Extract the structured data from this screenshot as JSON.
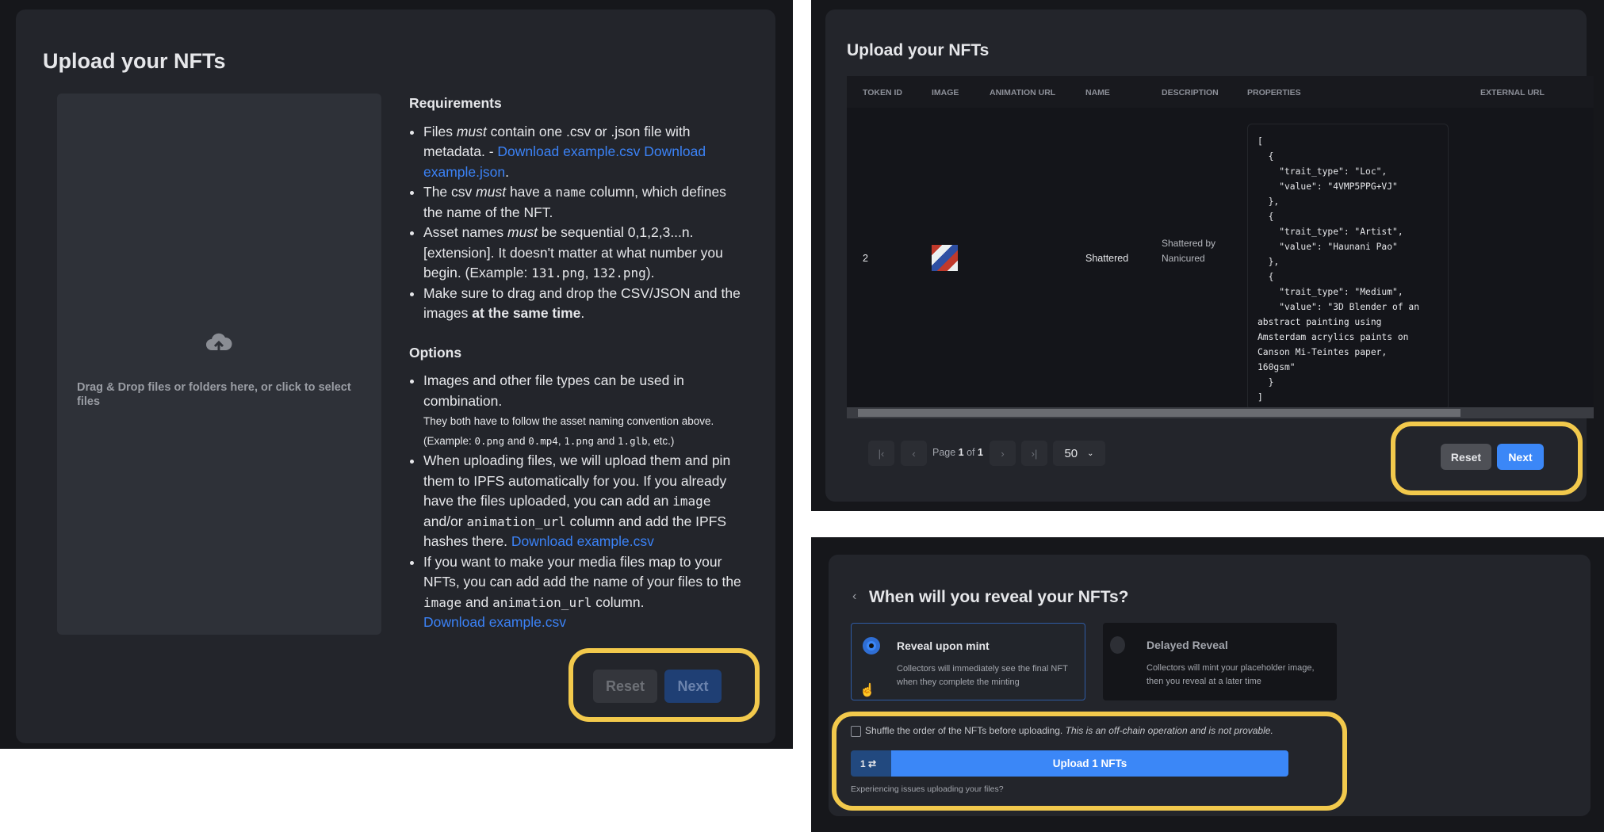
{
  "left": {
    "title": "Upload your NFTs",
    "dropzone": {
      "icon": "cloud-upload-icon",
      "text": "Drag & Drop files or folders here, or click to select files"
    },
    "requirements": {
      "heading": "Requirements",
      "items": [
        {
          "pre": "Files ",
          "em": "must",
          "post": " contain one .csv or .json file with metadata. - ",
          "link1": "Download example.csv",
          "link2": "Download example.json",
          "end": "."
        },
        {
          "pre": "The csv ",
          "em": "must",
          "mid": " have a ",
          "code": "name",
          "post": " column, which defines the name of the NFT."
        },
        {
          "pre": "Asset names ",
          "em": "must",
          "post": " be sequential 0,1,2,3...n.[extension]. It doesn't matter at what number you begin. (Example: ",
          "code1": "131.png",
          "sep": ", ",
          "code2": "132.png",
          "end": ")."
        },
        {
          "pre": "Make sure to drag and drop the CSV/JSON and the images ",
          "strong": "at the same time",
          "end": "."
        }
      ]
    },
    "options": {
      "heading": "Options",
      "item1": {
        "text": "Images and other file types can be used in combination.",
        "note1": "They both have to follow the asset naming convention above.",
        "note2_pre": "(Example: ",
        "c1": "0.png",
        "and1": " and ",
        "c2": "0.mp4",
        "sep1": ", ",
        "c3": "1.png",
        "and2": " and ",
        "c4": "1.glb",
        "note2_end": ", etc.)"
      },
      "item2": {
        "pre": "When uploading files, we will upload them and pin them to IPFS automatically for you. If you already have the files uploaded, you can add an ",
        "c1": "image",
        "mid": " and/or ",
        "c2": "animation_url",
        "post": " column and add the IPFS hashes there. ",
        "link": "Download example.csv"
      },
      "item3": {
        "pre": "If you want to make your media files map to your NFTs, you can add add the name of your files to the ",
        "c1": "image",
        "mid": " and ",
        "c2": "animation_url",
        "post": " column.",
        "link": "Download example.csv"
      }
    },
    "reset_label": "Reset",
    "next_label": "Next"
  },
  "table_view": {
    "title": "Upload your NFTs",
    "columns": [
      "Token ID",
      "Image",
      "Animation URL",
      "Name",
      "Description",
      "Properties",
      "External URL"
    ],
    "row": {
      "token_id": "2",
      "name": "Shattered",
      "description": "Shattered by Nanicured",
      "properties": "[\n  {\n    \"trait_type\": \"Loc\",\n    \"value\": \"4VMP5PPG+VJ\"\n  },\n  {\n    \"trait_type\": \"Artist\",\n    \"value\": \"Haunani Pao\"\n  },\n  {\n    \"trait_type\": \"Medium\",\n    \"value\": \"3D Blender of an\nabstract painting using\nAmsterdam acrylics paints on\nCanson Mi-Teintes paper,\n160gsm\"\n  }\n]"
    },
    "pagination": {
      "page_prefix": "Page ",
      "page": "1",
      "of": " of ",
      "total": "1",
      "page_size": "50"
    },
    "reset_label": "Reset",
    "next_label": "Next"
  },
  "reveal": {
    "title": "When will you reveal your NFTs?",
    "options": [
      {
        "label": "Reveal upon mint",
        "desc": "Collectors will immediately see the final NFT when they complete the minting",
        "selected": true
      },
      {
        "label": "Delayed Reveal",
        "desc": "Collectors will mint your placeholder image, then you reveal at a later time",
        "selected": false
      }
    ],
    "shuffle": {
      "checked": false,
      "text": "Shuffle the order of the NFTs before uploading.",
      "note": "This is an off-chain operation and is not provable."
    },
    "upload_count": "1 ⇄",
    "upload_label": "Upload 1 NFTs",
    "issues_text": "Experiencing issues uploading your files?"
  },
  "colors": {
    "accent": "#3b82f6",
    "highlight": "#f2c94c",
    "card": "#23252b"
  }
}
